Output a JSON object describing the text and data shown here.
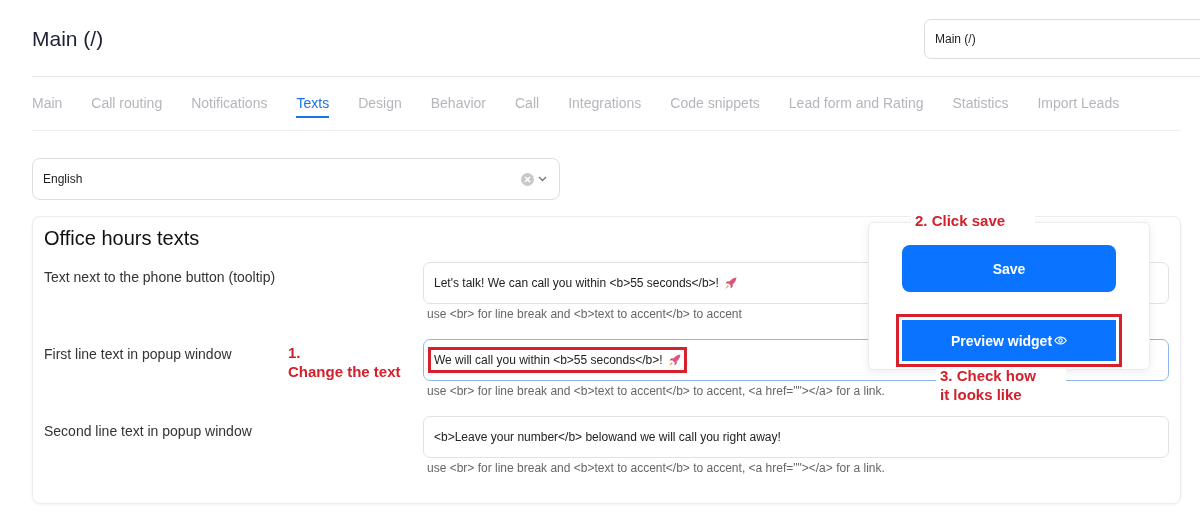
{
  "header": {
    "title": "Main (/)",
    "path_field": {
      "value": "Main  (/)"
    }
  },
  "tabs": [
    {
      "label": "Main",
      "selected": false
    },
    {
      "label": "Call routing",
      "selected": false
    },
    {
      "label": "Notifications",
      "selected": false
    },
    {
      "label": "Texts",
      "selected": true
    },
    {
      "label": "Design",
      "selected": false
    },
    {
      "label": "Behavior",
      "selected": false
    },
    {
      "label": "Call",
      "selected": false
    },
    {
      "label": "Integrations",
      "selected": false
    },
    {
      "label": "Code snippets",
      "selected": false
    },
    {
      "label": "Lead form and Rating",
      "selected": false
    },
    {
      "label": "Statistics",
      "selected": false
    },
    {
      "label": "Import Leads",
      "selected": false
    }
  ],
  "language_select": {
    "value": "English"
  },
  "section": {
    "title": "Office hours texts",
    "fields": [
      {
        "label": "Text next to the phone button (tooltip)",
        "value": "Let's talk! We can call you within <b>55 seconds</b>!",
        "emoji": true,
        "hint": "use <br> for line break and <b>text to accent</b> to accent",
        "focused": false,
        "highlighted": false
      },
      {
        "label": "First line text in popup window",
        "value": "We will call you within <b>55 seconds</b>!",
        "emoji": true,
        "hint": "use <br> for line break and <b>text to accent</b> to accent, <a href=\"\"></a> for a link.",
        "focused": true,
        "highlighted": true
      },
      {
        "label": "Second line text in popup window",
        "value": "<b>Leave your number</b> belowand we will call you right away!",
        "emoji": false,
        "hint": "use <br> for line break and <b>text to accent</b> to accent, <a href=\"\"></a> for a link.",
        "focused": false,
        "highlighted": false
      }
    ]
  },
  "action_panel": {
    "buttons": [
      {
        "label": "Save",
        "kind": "save",
        "highlighted": false
      },
      {
        "label": "Preview widget",
        "kind": "preview",
        "highlighted": true
      }
    ]
  },
  "annotations": [
    {
      "text": "1.\nChange the text"
    },
    {
      "text": "2. Click save"
    },
    {
      "text": "3. Check how\nit looks like"
    }
  ]
}
